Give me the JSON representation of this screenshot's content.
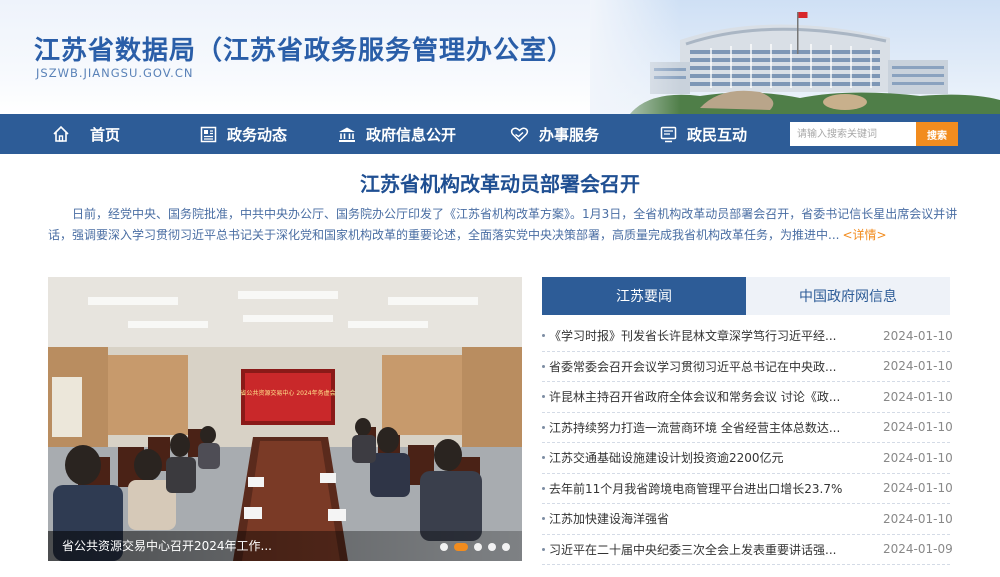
{
  "header": {
    "title": "江苏省数据局（江苏省政务服务管理办公室）",
    "domain": "JSZWB.JIANGSU.GOV.CN"
  },
  "nav": {
    "items": [
      {
        "label": "首页",
        "icon": "home-icon"
      },
      {
        "label": "政务动态",
        "icon": "news-icon"
      },
      {
        "label": "政府信息公开",
        "icon": "government-building-icon"
      },
      {
        "label": "办事服务",
        "icon": "heart-hand-icon"
      },
      {
        "label": "政民互动",
        "icon": "chat-screen-icon"
      }
    ],
    "search_placeholder": "请输入搜索关键词",
    "search_button": "搜索"
  },
  "headline": {
    "title": "江苏省机构改革动员部署会召开",
    "summary": "日前，经党中央、国务院批准，中共中央办公厅、国务院办公厅印发了《江苏省机构改革方案》。1月3日，全省机构改革动员部署会召开，省委书记信长星出席会议并讲话，强调要深入学习贯彻习近平总书记关于深化党和国家机构改革的重要论述，全面落实党中央决策部署，高质量完成我省机构改革任务，为推进中...",
    "more": "<详情>"
  },
  "photo": {
    "caption": "省公共资源交易中心召开2024年工作...",
    "screen_text": "省公共资源交易中心 2024年务虚会",
    "slide_count": 5,
    "active_slide": 2
  },
  "news": {
    "tabs": [
      "江苏要闻",
      "中国政府网信息"
    ],
    "active_tab": 0,
    "items": [
      {
        "title": "《学习时报》刊发省长许昆林文章深学笃行习近平经...",
        "date": "2024-01-10"
      },
      {
        "title": "省委常委会召开会议学习贯彻习近平总书记在中央政...",
        "date": "2024-01-10"
      },
      {
        "title": "许昆林主持召开省政府全体会议和常务会议 讨论《政...",
        "date": "2024-01-10"
      },
      {
        "title": "江苏持续努力打造一流营商环境 全省经营主体总数达...",
        "date": "2024-01-10"
      },
      {
        "title": "江苏交通基础设施建设计划投资逾2200亿元",
        "date": "2024-01-10"
      },
      {
        "title": "去年前11个月我省跨境电商管理平台进出口增长23.7%",
        "date": "2024-01-10"
      },
      {
        "title": "江苏加快建设海洋强省",
        "date": "2024-01-10"
      },
      {
        "title": "习近平在二十届中央纪委三次全会上发表重要讲话强...",
        "date": "2024-01-09"
      }
    ]
  },
  "colors": {
    "nav_blue": "#2d5c97",
    "title_blue": "#2a5ea8",
    "accent_orange": "#f28c1e"
  }
}
